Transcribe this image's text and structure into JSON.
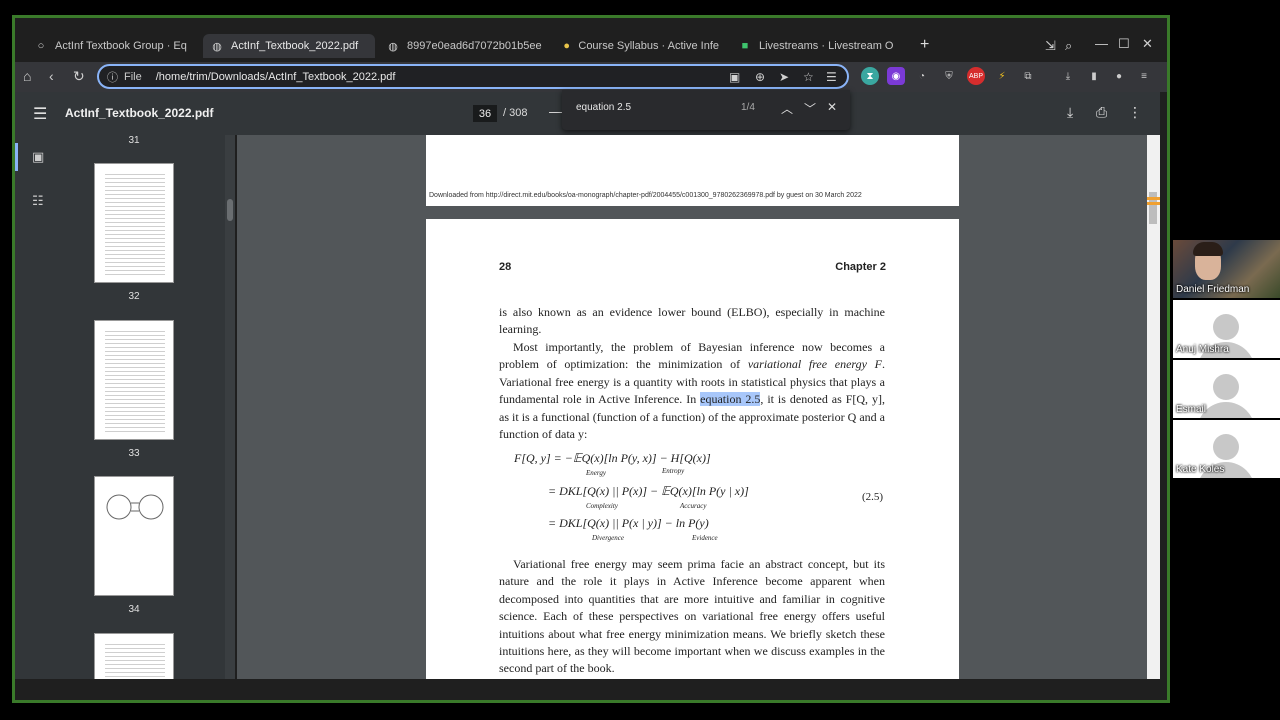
{
  "tabs": [
    {
      "label": "ActInf Textbook Group · Eq",
      "icon": "circle-icon",
      "active": false
    },
    {
      "label": "ActInf_Textbook_2022.pdf",
      "icon": "globe-icon",
      "active": true
    },
    {
      "label": "8997e0ead6d7072b01b5ee",
      "icon": "globe-icon",
      "active": false
    },
    {
      "label": "Course Syllabus · Active Infe",
      "icon": "chat-icon",
      "active": false
    },
    {
      "label": "Livestreams · Livestream O",
      "icon": "video-icon",
      "active": false
    }
  ],
  "address": {
    "scheme_label": "File",
    "url": "/home/trim/Downloads/ActInf_Textbook_2022.pdf"
  },
  "pdf": {
    "title": "ActInf_Textbook_2022.pdf",
    "current_page": "36",
    "total_pages": "/ 308"
  },
  "find": {
    "query": "equation 2.5",
    "count": "1/4"
  },
  "thumbnails": [
    {
      "label": "31"
    },
    {
      "label": "32"
    },
    {
      "label": "33"
    },
    {
      "label": "34"
    }
  ],
  "prev_page": {
    "download_note": "Downloaded from http://direct.mit.edu/books/oa-monograph/chapter-pdf/2004455/c001300_9780262369978.pdf by guest on 30 March 2022"
  },
  "page": {
    "number": "28",
    "chapter": "Chapter 2",
    "para1": "is also known as an evidence lower bound (ELBO), especially in machine learning.",
    "para2_a": "Most importantly, the problem of Bayesian inference now becomes a problem of optimization: the minimization of ",
    "para2_em": "variational free energy F",
    "para2_b": ". Variational free energy is a quantity with roots in statistical physics that plays a fundamental role in Active Inference. In ",
    "para2_hl": "equation 2.5",
    "para2_c": ", it is denoted as F[Q, y], as it is a functional (function of a function) of the approximate posterior Q and a function of data y:",
    "eq1": "F[Q, y] = −𝔼Q(x)[ln P(y, x)] − H[Q(x)]",
    "eq1_under1": "Energy",
    "eq1_under2": "Entropy",
    "eq2": "= DKL[Q(x) || P(x)] − 𝔼Q(x)[ln P(y | x)]",
    "eq2_under1": "Complexity",
    "eq2_under2": "Accuracy",
    "eq3": "= DKL[Q(x) || P(x | y)] − ln P(y)",
    "eq3_under1": "Divergence",
    "eq3_under2": "Evidence",
    "eq_number": "(2.5)",
    "para3": "Variational free energy may seem prima facie an abstract concept, but its nature and the role it plays in Active Inference become apparent when decomposed into quantities that are more intuitive and familiar in cognitive science. Each of these perspectives on variational free energy offers useful intuitions about what free energy minimization means. We briefly sketch these intuitions here, as they will become important when we discuss examples in the second part of the book."
  },
  "participants": [
    {
      "name": "Daniel Friedman"
    },
    {
      "name": "Anuj Mishra"
    },
    {
      "name": "Esmail"
    },
    {
      "name": "Kate Koles"
    }
  ],
  "colors": {
    "accent": "#8ab4f8",
    "highlight": "#a8c7fa",
    "frame_border": "#3a7a2a"
  }
}
